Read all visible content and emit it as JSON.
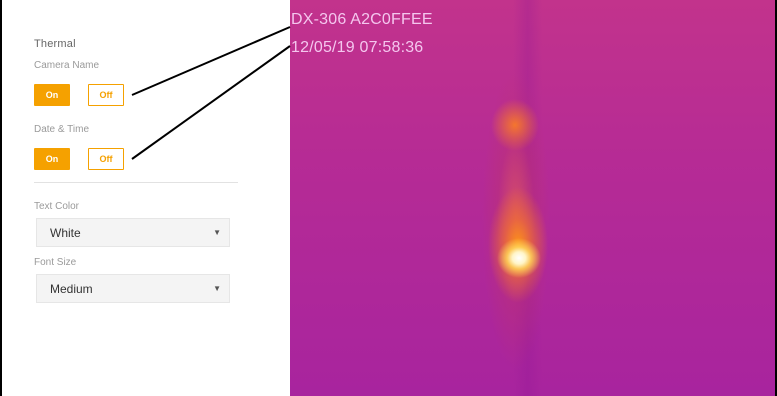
{
  "panel": {
    "section_title": "Thermal",
    "camera_name": {
      "label": "Camera Name",
      "on_label": "On",
      "off_label": "Off",
      "selected": "On"
    },
    "date_time": {
      "label": "Date & Time",
      "on_label": "On",
      "off_label": "Off",
      "selected": "On"
    },
    "text_color": {
      "label": "Text Color",
      "value": "White"
    },
    "font_size": {
      "label": "Font Size",
      "value": "Medium"
    }
  },
  "preview": {
    "camera_name_text": "DX-306 A2C0FFEE",
    "datetime_text": "12/05/19 07:58:36"
  },
  "colors": {
    "accent": "#f5a100",
    "overlay_text": "#f4c6ee"
  }
}
